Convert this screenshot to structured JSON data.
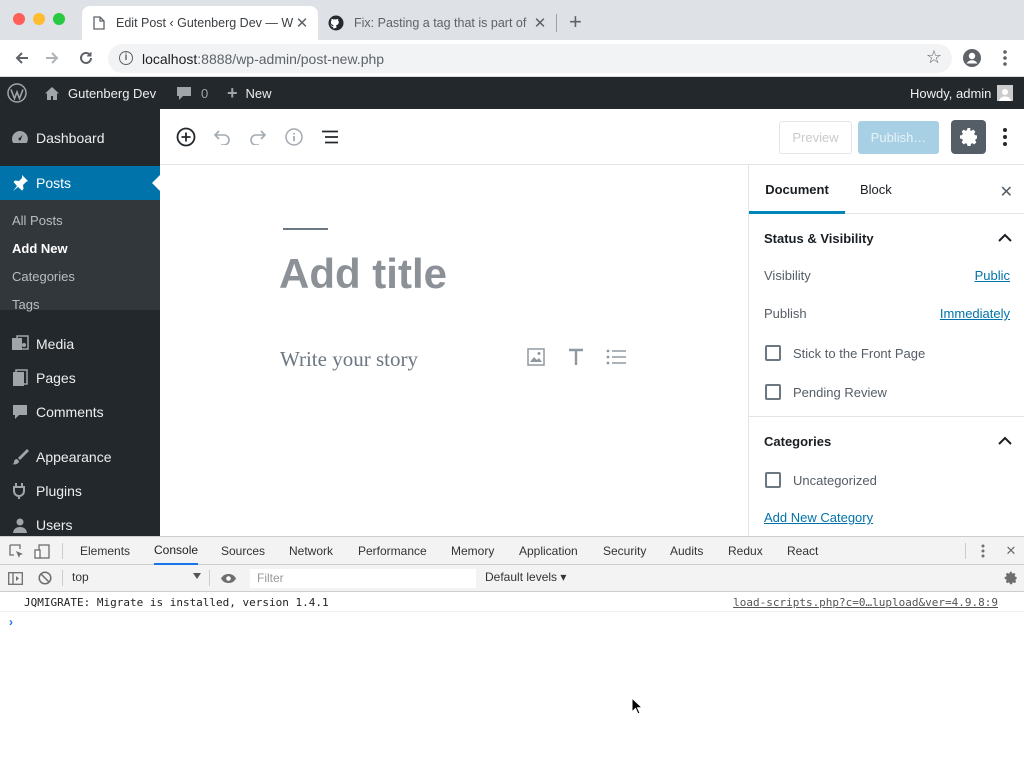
{
  "browser": {
    "tabs": [
      {
        "title": "Edit Post ‹ Gutenberg Dev — W",
        "active": true,
        "icon": "document-icon"
      },
      {
        "title": "Fix: Pasting a tag that is part of",
        "active": false,
        "icon": "github-icon"
      }
    ],
    "url_host": "localhost",
    "url_rest": ":8888/wp-admin/post-new.php",
    "controls": {
      "back": "back-arrow-icon",
      "forward": "forward-arrow-icon",
      "reload": "reload-icon",
      "bookmark": "star-icon",
      "profile": "profile-icon",
      "menu": "kebab-icon"
    }
  },
  "adminbar": {
    "site_name": "Gutenberg Dev",
    "comments_count": "0",
    "new_label": "New",
    "greeting": "Howdy, admin"
  },
  "sidebar": {
    "items": [
      {
        "label": "Dashboard",
        "icon": "dashboard-icon"
      },
      {
        "label": "Posts",
        "icon": "pin-icon",
        "current": true
      },
      {
        "label": "Media",
        "icon": "media-icon"
      },
      {
        "label": "Pages",
        "icon": "pages-icon"
      },
      {
        "label": "Comments",
        "icon": "comment-icon"
      },
      {
        "label": "Appearance",
        "icon": "brush-icon"
      },
      {
        "label": "Plugins",
        "icon": "plug-icon"
      },
      {
        "label": "Users",
        "icon": "user-icon"
      }
    ],
    "submenu": [
      "All Posts",
      "Add New",
      "Categories",
      "Tags"
    ],
    "submenu_current": "Add New"
  },
  "editor": {
    "header": {
      "preview_label": "Preview",
      "publish_label": "Publish…"
    },
    "title_placeholder": "Add title",
    "body_placeholder": "Write your story"
  },
  "panel": {
    "tabs": [
      "Document",
      "Block"
    ],
    "active_tab": "Document",
    "status_section": {
      "title": "Status & Visibility",
      "visibility_label": "Visibility",
      "visibility_value": "Public",
      "publish_label": "Publish",
      "publish_value": "Immediately",
      "stick_label": "Stick to the Front Page",
      "pending_label": "Pending Review"
    },
    "categories_section": {
      "title": "Categories",
      "uncategorized_label": "Uncategorized",
      "add_new_link": "Add New Category"
    }
  },
  "devtools": {
    "tabs": [
      "Elements",
      "Console",
      "Sources",
      "Network",
      "Performance",
      "Memory",
      "Application",
      "Security",
      "Audits",
      "Redux",
      "React"
    ],
    "active_tab": "Console",
    "context": "top",
    "filter_placeholder": "Filter",
    "levels": "Default levels",
    "console_message": "JQMIGRATE: Migrate is installed, version 1.4.1",
    "console_source": "load-scripts.php?c=0…&load%5B%5D=jquery-core,jquery-migrate,utils,plupload&ver=4.9.8:9",
    "console_source_display": "load-scripts.php?c=0…lupload&ver=4.9.8:9",
    "prompt": "›"
  },
  "colors": {
    "wp_dark": "#23282d",
    "wp_blue": "#0073aa",
    "publish_disabled": "#a8d0e4",
    "settings_active": "#555d66"
  }
}
